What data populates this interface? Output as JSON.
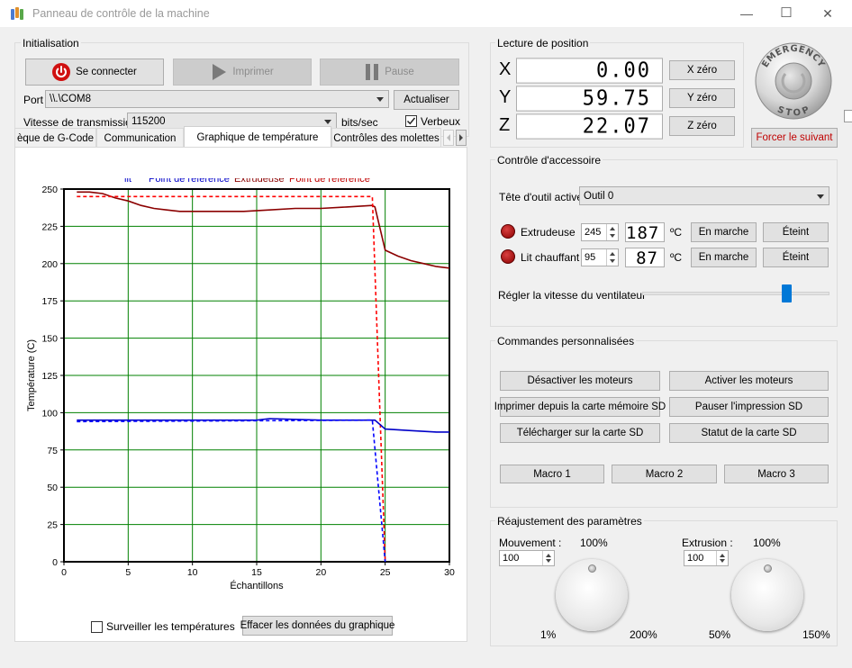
{
  "window": {
    "title": "Panneau de contrôle de la machine",
    "minimize": "—",
    "maximize": "☐",
    "close": "✕"
  },
  "init": {
    "group_title": "Initialisation",
    "connect_label": "Se connecter",
    "print_label": "Imprimer",
    "pause_label": "Pause",
    "port_label": "Port",
    "port_value": "\\\\.\\COM8",
    "refresh_label": "Actualiser",
    "baud_label": "Vitesse de transmission",
    "baud_value": "115200",
    "baud_unit": "bits/sec",
    "verbose_label": "Verbeux",
    "verbose_checked": true
  },
  "position": {
    "group_title": "Lecture de position",
    "axes": [
      {
        "axis": "X",
        "value": "0.00",
        "zero_label": "X zéro"
      },
      {
        "axis": "Y",
        "value": "59.75",
        "zero_label": "Y zéro"
      },
      {
        "axis": "Z",
        "value": "22.07",
        "zero_label": "Z zéro"
      }
    ],
    "emergency_top": "EMERGENCY",
    "emergency_bottom": "STOP",
    "force_label": "Forcer le suivant"
  },
  "tabs": [
    {
      "label": "èque de G-Code",
      "active": false
    },
    {
      "label": "Communication",
      "active": false
    },
    {
      "label": "Graphique de température",
      "active": true
    },
    {
      "label": "Contrôles des molettes",
      "active": false
    }
  ],
  "accessory": {
    "group_title": "Contrôle d'accessoire",
    "tool_label": "Tête d'outil active",
    "tool_value": "Outil 0",
    "extruder_label": "Extrudeuse",
    "extruder_set": "245",
    "extruder_temp": "187",
    "bed_label": "Lit chauffant",
    "bed_set": "95",
    "bed_temp": "87",
    "unit": "ºC",
    "on_label": "En marche",
    "off_label": "Éteint",
    "fan_label": "Régler la vitesse du ventilateur",
    "fan_level": 0.78
  },
  "custom": {
    "group_title": "Commandes personnalisées",
    "buttons": [
      "Désactiver les moteurs",
      "Activer les moteurs",
      "Imprimer depuis la carte mémoire SD",
      "Pauser l'impression SD",
      "Télécharger sur la carte SD",
      "Statut de la carte SD"
    ],
    "macros": [
      "Macro 1",
      "Macro 2",
      "Macro 3"
    ]
  },
  "adjust": {
    "group_title": "Réajustement des paramètres",
    "move_label": "Mouvement :",
    "move_value": "100",
    "move_pct": "100%",
    "move_min": "1%",
    "move_max": "200%",
    "ext_label": "Extrusion :",
    "ext_value": "100",
    "ext_pct": "100%",
    "ext_min": "50%",
    "ext_max": "150%"
  },
  "chart_footer": {
    "monitor_label": "Surveiller les températures",
    "clear_label": "Effacer les données du graphique"
  },
  "colors": {
    "bed": "#0000c8",
    "bed_setpoint": "#0000ff",
    "extruder": "#8b0000",
    "extruder_setpoint": "#ff0000",
    "grid": "#008000",
    "force_text": "#c00000"
  },
  "chart_data": {
    "type": "line",
    "legend": [
      {
        "text": "lit",
        "color": "#0000c8"
      },
      {
        "text": "Point de référence",
        "color": "#0000c8"
      },
      {
        "text": "Extrudeuse",
        "color": "#8b0000"
      },
      {
        "text": "Point de référence",
        "color": "#c00000"
      }
    ],
    "xlabel": "Échantillons",
    "ylabel": "Température (C)",
    "xlim": [
      0,
      30
    ],
    "ylim": [
      0,
      250
    ],
    "xticks": [
      0,
      5,
      10,
      15,
      20,
      25,
      30
    ],
    "yticks": [
      0,
      25,
      50,
      75,
      100,
      125,
      150,
      175,
      200,
      225,
      250
    ],
    "grid": true,
    "series": [
      {
        "name": "Extrudeuse",
        "color": "#8b0000",
        "dashed": false,
        "x": [
          1,
          2,
          3,
          4,
          5,
          6,
          7,
          8,
          9,
          10,
          12,
          14,
          16,
          18,
          19,
          20,
          22,
          24,
          24.2,
          25,
          26,
          27,
          28,
          29,
          30
        ],
        "y": [
          248,
          248,
          247,
          244,
          242,
          239,
          237,
          236,
          235,
          235,
          235,
          235,
          236,
          237,
          237,
          237,
          238,
          239,
          238,
          209,
          205,
          202,
          200,
          198,
          197
        ]
      },
      {
        "name": "Point de référence",
        "color": "#ff0000",
        "dashed": true,
        "x": [
          1,
          24,
          25
        ],
        "y": [
          245,
          245,
          0
        ]
      },
      {
        "name": "lit",
        "color": "#0000c8",
        "dashed": false,
        "x": [
          1,
          5,
          10,
          15,
          16,
          20,
          24,
          24.2,
          25,
          27,
          29,
          30
        ],
        "y": [
          95,
          95,
          95,
          95,
          96,
          95,
          95,
          95,
          89,
          88,
          87,
          87
        ]
      },
      {
        "name": "Point de référence",
        "color": "#0000ff",
        "dashed": true,
        "x": [
          1,
          24,
          25
        ],
        "y": [
          94,
          95,
          0
        ]
      }
    ]
  }
}
